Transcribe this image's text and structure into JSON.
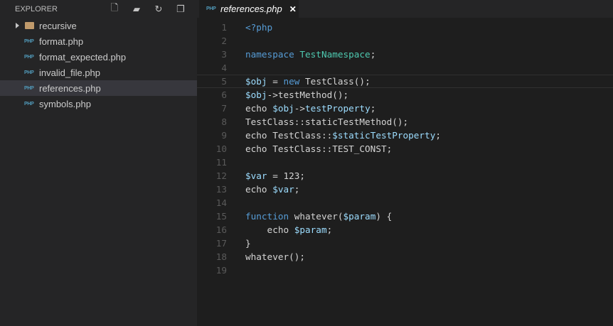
{
  "sidebar": {
    "title": "EXPLORER",
    "actions": [
      {
        "name": "new-file-icon",
        "glyph": "🗋"
      },
      {
        "name": "new-folder-icon",
        "glyph": "▰"
      },
      {
        "name": "refresh-icon",
        "glyph": "↻"
      },
      {
        "name": "collapse-all-icon",
        "glyph": "❐"
      }
    ],
    "items": [
      {
        "label": "recursive",
        "type": "folder"
      },
      {
        "label": "format.php",
        "type": "php"
      },
      {
        "label": "format_expected.php",
        "type": "php"
      },
      {
        "label": "invalid_file.php",
        "type": "php"
      },
      {
        "label": "references.php",
        "type": "php",
        "selected": true
      },
      {
        "label": "symbols.php",
        "type": "php"
      }
    ],
    "php_badge": "PHP"
  },
  "tab": {
    "label": "references.php",
    "badge": "PHP",
    "close": "✕"
  },
  "editor": {
    "current_line": 5,
    "lines": [
      [
        [
          "<?php",
          "kw"
        ]
      ],
      [],
      [
        [
          "namespace ",
          "kw"
        ],
        [
          "TestNamespace",
          "ns"
        ],
        [
          ";",
          "tx"
        ]
      ],
      [],
      [
        [
          "$obj",
          "var"
        ],
        [
          " = ",
          "tx"
        ],
        [
          "new",
          "kw"
        ],
        [
          " TestClass();",
          "tx"
        ]
      ],
      [
        [
          "$obj",
          "var"
        ],
        [
          "->testMethod();",
          "tx"
        ]
      ],
      [
        [
          "echo ",
          "tx"
        ],
        [
          "$obj",
          "var"
        ],
        [
          "->",
          "tx"
        ],
        [
          "testProperty",
          "var"
        ],
        [
          ";",
          "tx"
        ]
      ],
      [
        [
          "TestClass::staticTestMethod();",
          "tx"
        ]
      ],
      [
        [
          "echo TestClass::",
          "tx"
        ],
        [
          "$staticTestProperty",
          "var"
        ],
        [
          ";",
          "tx"
        ]
      ],
      [
        [
          "echo TestClass::TEST_CONST;",
          "tx"
        ]
      ],
      [],
      [
        [
          "$var",
          "var"
        ],
        [
          " = 123;",
          "tx"
        ]
      ],
      [
        [
          "echo ",
          "tx"
        ],
        [
          "$var",
          "var"
        ],
        [
          ";",
          "tx"
        ]
      ],
      [],
      [
        [
          "function",
          "kw"
        ],
        [
          " whatever(",
          "tx"
        ],
        [
          "$param",
          "var"
        ],
        [
          ") {",
          "tx"
        ]
      ],
      [
        [
          "    echo ",
          "tx"
        ],
        [
          "$param",
          "var"
        ],
        [
          ";",
          "tx"
        ]
      ],
      [
        [
          "}",
          "tx"
        ]
      ],
      [
        [
          "whatever();",
          "tx"
        ]
      ],
      []
    ]
  }
}
